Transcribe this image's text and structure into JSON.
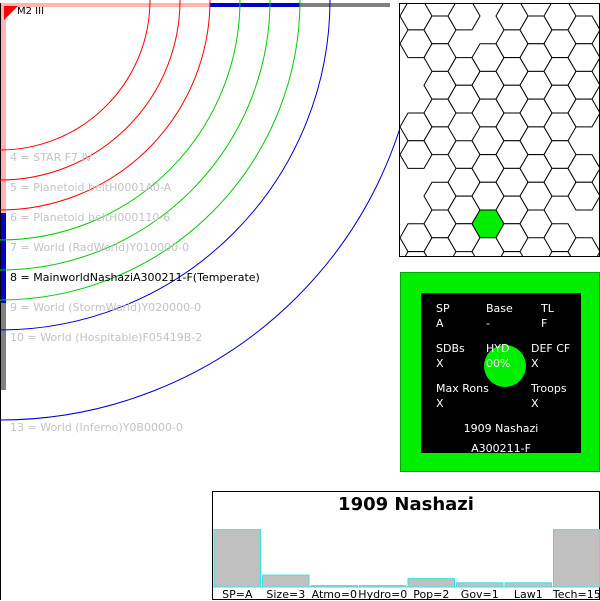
{
  "system": {
    "star_label": "M2 III",
    "orbits": [
      {
        "label": "4 = STAR F7 IV",
        "active": false
      },
      {
        "label": "5 = Planetoid beltH0001A0-A",
        "active": false
      },
      {
        "label": "6 = Planetoid beltH000110-6",
        "active": false
      },
      {
        "label": "7 = World  (RadWorld)Y010000-0",
        "active": false
      },
      {
        "label": "8 = MainworldNashaziA300211-F(Temperate)",
        "active": true
      },
      {
        "label": "9 = World  (StormWorld)Y020000-0",
        "active": false
      },
      {
        "label": "10 = World  (Hospitable)F05419B-2",
        "active": false
      },
      {
        "label": "13 = World  (Inferno)Y0B0000-0",
        "active": false
      }
    ],
    "colors": {
      "inner_orbit": "#ff0000",
      "green_orbit": "#00cc00",
      "outer_orbit": "#0000cc",
      "star": "#ff0000"
    }
  },
  "hexmap": {
    "highlight_color": "#00ee00",
    "highlighted_cell": "col3-row7"
  },
  "uwp": {
    "sp_label": "SP",
    "sp_value": "A",
    "base_label": "Base",
    "base_value": "-",
    "tl_label": "TL",
    "tl_value": "F",
    "sdbs_label": "SDBs",
    "sdbs_value": "X",
    "hyd_label": "HYD",
    "hyd_value": "00%",
    "def_label": "DEF CF",
    "def_value": "X",
    "ron_label": "Max Rons",
    "ron_value": "X",
    "troops_label": "Troops",
    "troops_value": "X",
    "name": "1909 Nashazi",
    "code": "A300211-F"
  },
  "bars": {
    "title": "1909 Nashazi",
    "items": [
      {
        "label": "SP=A",
        "level": 0.82
      },
      {
        "label": "Size=3",
        "level": 0.17
      },
      {
        "label": "Atmo=0",
        "level": 0.02
      },
      {
        "label": "Hydro=0",
        "level": 0.02
      },
      {
        "label": "Pop=2",
        "level": 0.12
      },
      {
        "label": "Gov=1",
        "level": 0.06
      },
      {
        "label": "Law1",
        "level": 0.06
      },
      {
        "label": "Tech=15",
        "level": 0.82
      }
    ],
    "bar_color": "#c0c0c0",
    "border_color": "#40e0e0"
  }
}
